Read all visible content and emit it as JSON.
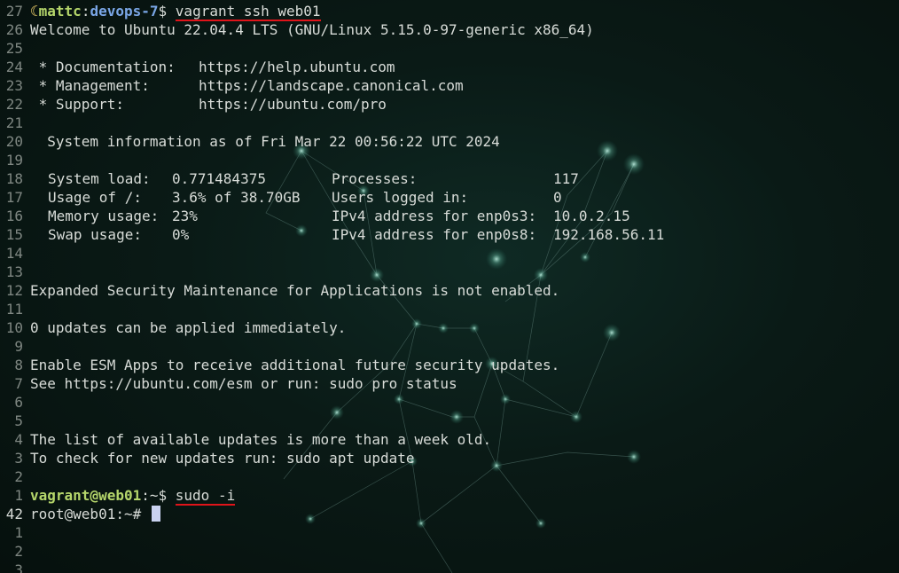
{
  "gutter": [
    "27",
    "26",
    "25",
    "24",
    "23",
    "22",
    "21",
    "20",
    "19",
    "18",
    "17",
    "16",
    "15",
    "14",
    "13",
    "12",
    "11",
    "10",
    "9",
    "8",
    "7",
    "6",
    "5",
    "4",
    "3",
    "2",
    "1",
    "42",
    "1",
    "2",
    "3"
  ],
  "prompt1": {
    "icon": "crescent-moon-icon",
    "user": "mattc",
    "dir": "devops-7",
    "symbol": "$",
    "command": "vagrant ssh web01"
  },
  "welcome": "Welcome to Ubuntu 22.04.4 LTS (GNU/Linux 5.15.0-97-generic x86_64)",
  "links": [
    {
      "label": " * Documentation:",
      "url": "https://help.ubuntu.com"
    },
    {
      "label": " * Management:",
      "url": "https://landscape.canonical.com"
    },
    {
      "label": " * Support:",
      "url": "https://ubuntu.com/pro"
    }
  ],
  "sysinfo_header": "  System information as of Fri Mar 22 00:56:22 UTC 2024",
  "stats": [
    {
      "k1": "System load:",
      "v1": "0.771484375",
      "k2": "Processes:",
      "v2": "117"
    },
    {
      "k1": "Usage of /:",
      "v1": "3.6% of 38.70GB",
      "k2": "Users logged in:",
      "v2": "0"
    },
    {
      "k1": "Memory usage:",
      "v1": "23%",
      "k2": "IPv4 address for enp0s3:",
      "v2": "10.0.2.15"
    },
    {
      "k1": "Swap usage:",
      "v1": "0%",
      "k2": "IPv4 address for enp0s8:",
      "v2": "192.168.56.11"
    }
  ],
  "esm_notice": "Expanded Security Maintenance for Applications is not enabled.",
  "updates": "0 updates can be applied immediately.",
  "esm_apps": "Enable ESM Apps to receive additional future security updates.",
  "esm_see": "See https://ubuntu.com/esm or run: sudo pro status",
  "list_old": "The list of available updates is more than a week old.",
  "check_updates": "To check for new updates run: sudo apt update",
  "prompt2": {
    "user_host": "vagrant@web01",
    "path": ":~$",
    "command": "sudo -i"
  },
  "prompt3": "root@web01:~# ",
  "colors": {
    "background": "#07120f",
    "prompt_green": "#b5d66b",
    "dir_blue": "#7aa6e6",
    "underline_red": "#e0141a",
    "cursor": "#c9d2f0"
  }
}
